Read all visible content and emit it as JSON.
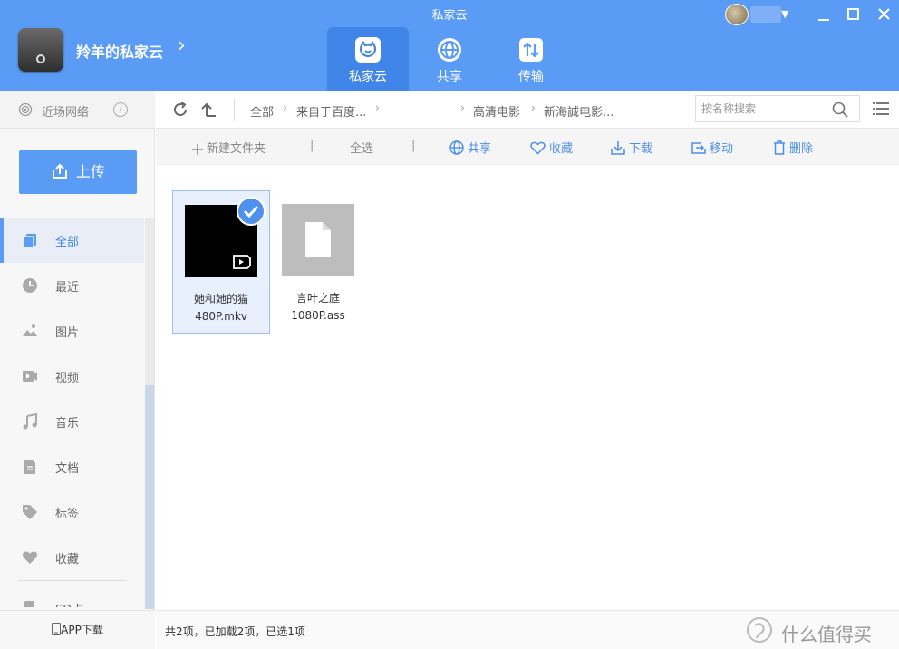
{
  "window": {
    "title": "私家云"
  },
  "header": {
    "device_name": "羚羊的私家云",
    "tabs": [
      {
        "label": "私家云",
        "icon": "cloud-cat-icon",
        "active": true
      },
      {
        "label": "共享",
        "icon": "globe-icon",
        "active": false
      },
      {
        "label": "传输",
        "icon": "transfer-icon",
        "active": false
      }
    ]
  },
  "sidebar": {
    "nearby_label": "近场网络",
    "upload_label": "上传",
    "items": [
      {
        "label": "全部",
        "icon": "files-icon",
        "active": true
      },
      {
        "label": "最近",
        "icon": "clock-icon"
      },
      {
        "label": "图片",
        "icon": "image-icon"
      },
      {
        "label": "视频",
        "icon": "video-icon"
      },
      {
        "label": "音乐",
        "icon": "music-icon"
      },
      {
        "label": "文档",
        "icon": "document-icon"
      },
      {
        "label": "标签",
        "icon": "tag-icon"
      },
      {
        "label": "收藏",
        "icon": "heart-icon"
      }
    ],
    "sd_label": "SD卡",
    "app_download_label": "APP下载"
  },
  "address": {
    "crumbs": [
      "全部",
      "来自于百度...",
      "高清电影",
      "新海誠电影..."
    ],
    "search_placeholder": "按名称搜索"
  },
  "toolbar": {
    "new_folder": "新建文件夹",
    "select_all": "全选",
    "share": "共享",
    "favorite": "收藏",
    "download": "下载",
    "move": "移动",
    "delete": "删除"
  },
  "files": [
    {
      "name_line1": "她和她的猫",
      "name_line2": "480P.mkv",
      "type": "video",
      "selected": true
    },
    {
      "name_line1": "言叶之庭",
      "name_line2": "1080P.ass",
      "type": "document",
      "selected": false
    }
  ],
  "status": {
    "text": "共2项，已加载2项，已选1项"
  },
  "watermark": {
    "text": "什么值得买"
  },
  "colors": {
    "accent": "#5a9bf6",
    "selected_bg": "#e7f0fc"
  }
}
